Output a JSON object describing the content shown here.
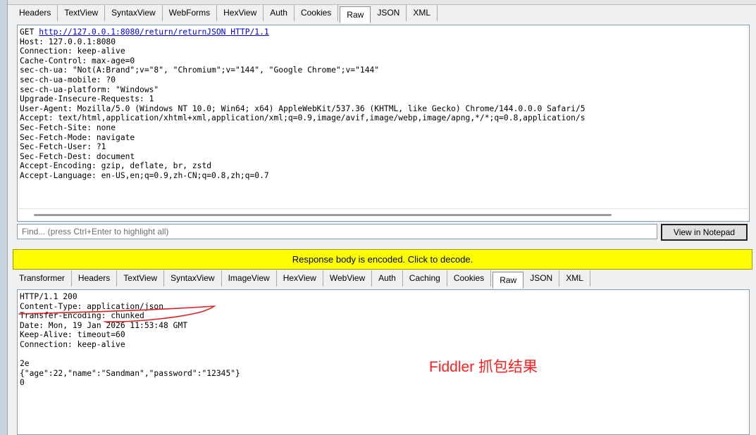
{
  "request": {
    "tabs": [
      "Headers",
      "TextView",
      "SyntaxView",
      "WebForms",
      "HexView",
      "Auth",
      "Cookies",
      "Raw",
      "JSON",
      "XML"
    ],
    "active_tab": "Raw",
    "request_line": {
      "method": "GET",
      "url": "http://127.0.0.1:8080/return/returnJSON",
      "protocol": "HTTP/1.1"
    },
    "headers": [
      "Host: 127.0.0.1:8080",
      "Connection: keep-alive",
      "Cache-Control: max-age=0",
      "sec-ch-ua: \"Not(A:Brand\";v=\"8\", \"Chromium\";v=\"144\", \"Google Chrome\";v=\"144\"",
      "sec-ch-ua-mobile: ?0",
      "sec-ch-ua-platform: \"Windows\"",
      "Upgrade-Insecure-Requests: 1",
      "User-Agent: Mozilla/5.0 (Windows NT 10.0; Win64; x64) AppleWebKit/537.36 (KHTML, like Gecko) Chrome/144.0.0.0 Safari/5",
      "Accept: text/html,application/xhtml+xml,application/xml;q=0.9,image/avif,image/webp,image/apng,*/*;q=0.8,application/s",
      "Sec-Fetch-Site: none",
      "Sec-Fetch-Mode: navigate",
      "Sec-Fetch-User: ?1",
      "Sec-Fetch-Dest: document",
      "Accept-Encoding: gzip, deflate, br, zstd",
      "Accept-Language: en-US,en;q=0.9,zh-CN;q=0.8,zh;q=0.7"
    ]
  },
  "find": {
    "placeholder": "Find... (press Ctrl+Enter to highlight all)",
    "notepad_label": "View in Notepad"
  },
  "banner": {
    "text": "Response body is encoded. Click to decode."
  },
  "response": {
    "tabs": [
      "Transformer",
      "Headers",
      "TextView",
      "SyntaxView",
      "ImageView",
      "HexView",
      "WebView",
      "Auth",
      "Caching",
      "Cookies",
      "Raw",
      "JSON",
      "XML"
    ],
    "active_tab": "Raw",
    "lines": [
      "HTTP/1.1 200",
      "Content-Type: application/json",
      "Transfer-Encoding: chunked",
      "Date: Mon, 19 Jan 2026 11:53:48 GMT",
      "Keep-Alive: timeout=60",
      "Connection: keep-alive",
      "",
      "2e",
      "{\"age\":22,\"name\":\"Sandman\",\"password\":\"12345\"}",
      "0"
    ]
  },
  "annotation": {
    "text": "Fiddler 抓包结果",
    "color": "#ff1f1f"
  }
}
